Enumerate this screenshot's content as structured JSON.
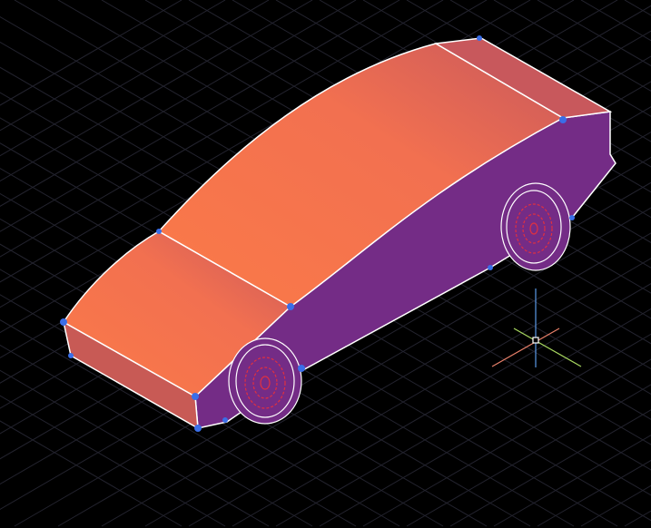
{
  "viewport": {
    "background": "#000000",
    "grid_color": "#2a2a36"
  },
  "model": {
    "name": "car",
    "body_color_light": "#fb7a48",
    "body_color_dark": "#c8585c",
    "side_color": "#742c86",
    "edge_color": "#ffffff",
    "grip_color": "#3a6ee8",
    "wheel_hub_color": "#e03040"
  },
  "ucs_icon": {
    "x_color": "#e8806a",
    "y_color": "#a8d860",
    "z_color": "#5a9ae8"
  }
}
